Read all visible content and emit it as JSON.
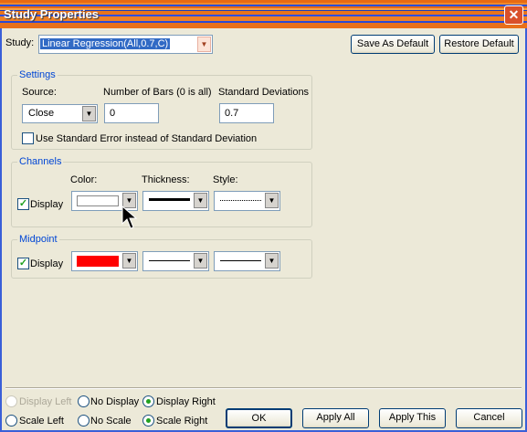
{
  "window": {
    "title": "Study Properties",
    "close_glyph": "✕"
  },
  "study": {
    "label": "Study:",
    "selected": "Linear Regression(All,0.7,C)"
  },
  "buttons": {
    "save_default": "Save As Default",
    "restore_default": "Restore Default",
    "ok": "OK",
    "apply_all": "Apply All",
    "apply_this": "Apply This",
    "cancel": "Cancel"
  },
  "settings": {
    "group_label": "Settings",
    "source_label": "Source:",
    "source_value": "Close",
    "bars_label": "Number of Bars (0 is all)",
    "bars_value": "0",
    "stddev_label": "Standard Deviations",
    "stddev_value": "0.7",
    "use_std_error_label": "Use Standard Error instead of Standard Deviation",
    "use_std_error_checked": false
  },
  "channels": {
    "group_label": "Channels",
    "display_label": "Display",
    "display_checked": true,
    "color_label": "Color:",
    "thickness_label": "Thickness:",
    "style_label": "Style:",
    "color_value": "#ffffff",
    "thickness": "thick",
    "style": "dotted"
  },
  "midpoint": {
    "group_label": "Midpoint",
    "display_label": "Display",
    "display_checked": true,
    "color_value": "#ff0000",
    "thickness": "thin",
    "style": "solid"
  },
  "scale_options": {
    "display_left": "Display Left",
    "no_display": "No Display",
    "display_right": "Display Right",
    "scale_left": "Scale Left",
    "no_scale": "No Scale",
    "scale_right": "Scale Right"
  },
  "icons": {
    "dropdown": "chevron-down-icon",
    "cursor": "mouse-pointer-icon",
    "check": "checkmark-icon"
  },
  "colors": {
    "titlebar_orange": "#e86a12",
    "titlebar_blue": "#2a4fd8",
    "group_label": "#0046d5",
    "dialog_bg": "#ece9d8"
  }
}
